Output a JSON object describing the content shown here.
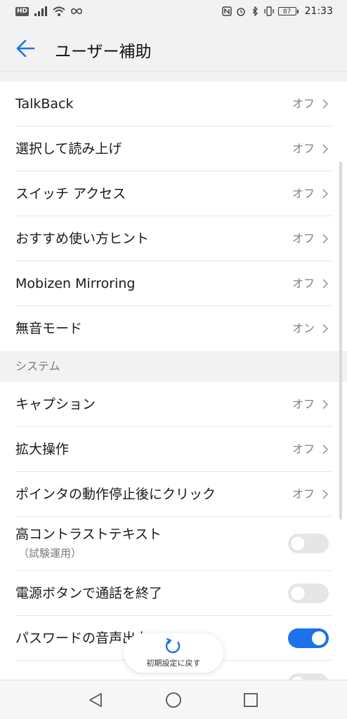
{
  "status_bar": {
    "hd_label": "HD",
    "battery_level": "87",
    "time": "21:33"
  },
  "header": {
    "title": "ユーザー補助"
  },
  "colors": {
    "accent": "#1a73e8",
    "background": "#ffffff",
    "section_background": "#f2f2f2"
  },
  "services": {
    "items": [
      {
        "label": "TalkBack",
        "value": "オフ"
      },
      {
        "label": "選択して読み上げ",
        "value": "オフ"
      },
      {
        "label": "スイッチ アクセス",
        "value": "オフ"
      },
      {
        "label": "おすすめ使い方ヒント",
        "value": "オフ"
      },
      {
        "label": "Mobizen Mirroring",
        "value": "オフ"
      },
      {
        "label": "無音モード",
        "value": "オン"
      }
    ]
  },
  "system": {
    "header": "システム",
    "items": [
      {
        "label": "キャプション",
        "value": "オフ"
      },
      {
        "label": "拡大操作",
        "value": "オフ"
      },
      {
        "label": "ポインタの動作停止後にクリック",
        "value": "オフ"
      }
    ],
    "toggles": [
      {
        "label": "高コントラストテキスト",
        "sublabel": "（試験運用）",
        "on": false
      },
      {
        "label": "電源ボタンで通話を終了",
        "on": false
      },
      {
        "label": "パスワードの音声出力",
        "on": true
      }
    ]
  },
  "reset_button": {
    "label": "初期設定に戻す"
  }
}
